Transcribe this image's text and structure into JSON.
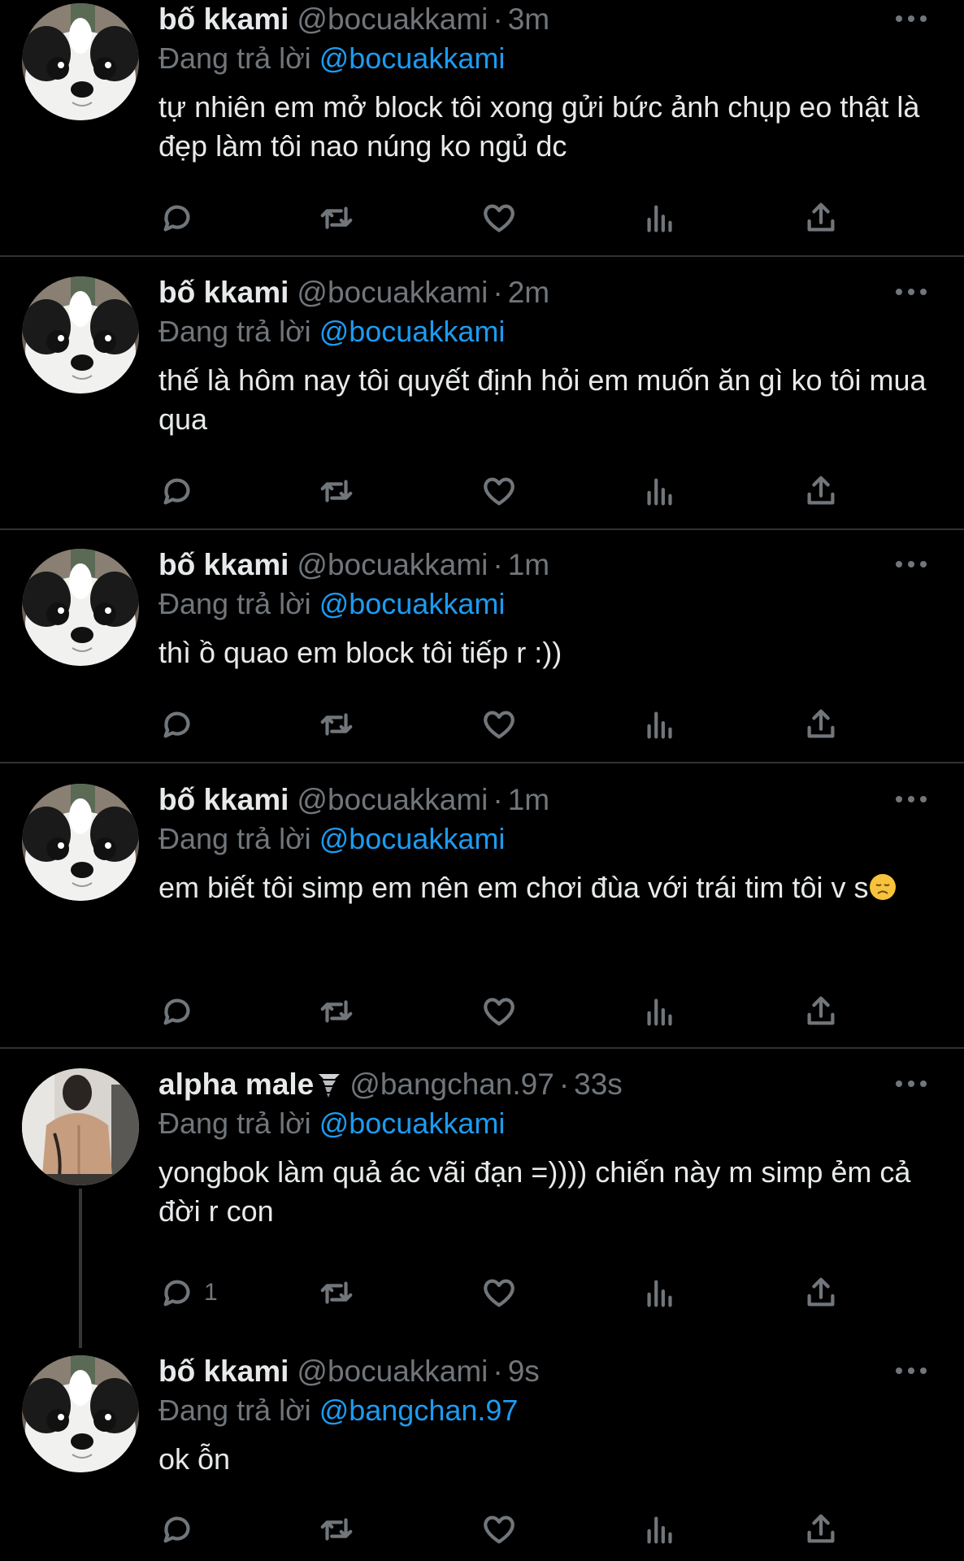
{
  "reply_prefix": "Đang trả lời",
  "tweets": [
    {
      "name": "bố kkami",
      "handle": "@bocuakkami",
      "time": "3m",
      "reply_to": "@bocuakkami",
      "text": "tự nhiên em mở block tôi xong gửi bức ảnh chụp eo thật là đẹp làm tôi nao núng ko ngủ dc",
      "avatar": "dog-avatar"
    },
    {
      "name": "bố kkami",
      "handle": "@bocuakkami",
      "time": "2m",
      "reply_to": "@bocuakkami",
      "text": "thế là hôm nay tôi quyết định hỏi em muốn ăn gì ko tôi mua qua",
      "avatar": "dog-avatar"
    },
    {
      "name": "bố kkami",
      "handle": "@bocuakkami",
      "time": "1m",
      "reply_to": "@bocuakkami",
      "text": "thì ồ quao em block tôi tiếp r :))",
      "avatar": "dog-avatar"
    },
    {
      "name": "bố kkami",
      "handle": "@bocuakkami",
      "time": "1m",
      "reply_to": "@bocuakkami",
      "text": "em biết tôi simp em nên em chơi đùa với trái tim tôi v s",
      "text_emoji": "disappointed-face",
      "avatar": "dog-avatar"
    },
    {
      "name": "alpha male",
      "name_emoji": "tornado",
      "handle": "@bangchan.97",
      "time": "33s",
      "reply_to": "@bocuakkami",
      "text": "yongbok làm quả ác vãi đạn =)))) chiến này m simp ẻm cả đời r con",
      "reply_count": "1",
      "avatar": "person-back-avatar"
    },
    {
      "name": "bố kkami",
      "handle": "@bocuakkami",
      "time": "9s",
      "reply_to": "@bangchan.97",
      "text": "ok ỗn",
      "avatar": "dog-avatar"
    }
  ],
  "colors": {
    "background": "#000000",
    "text": "#e7e9ea",
    "secondary": "#71767b",
    "link": "#1d9bf0",
    "divider": "#2f3336"
  },
  "icons": [
    "reply-icon",
    "retweet-icon",
    "like-icon",
    "views-icon",
    "share-icon",
    "more-icon"
  ]
}
